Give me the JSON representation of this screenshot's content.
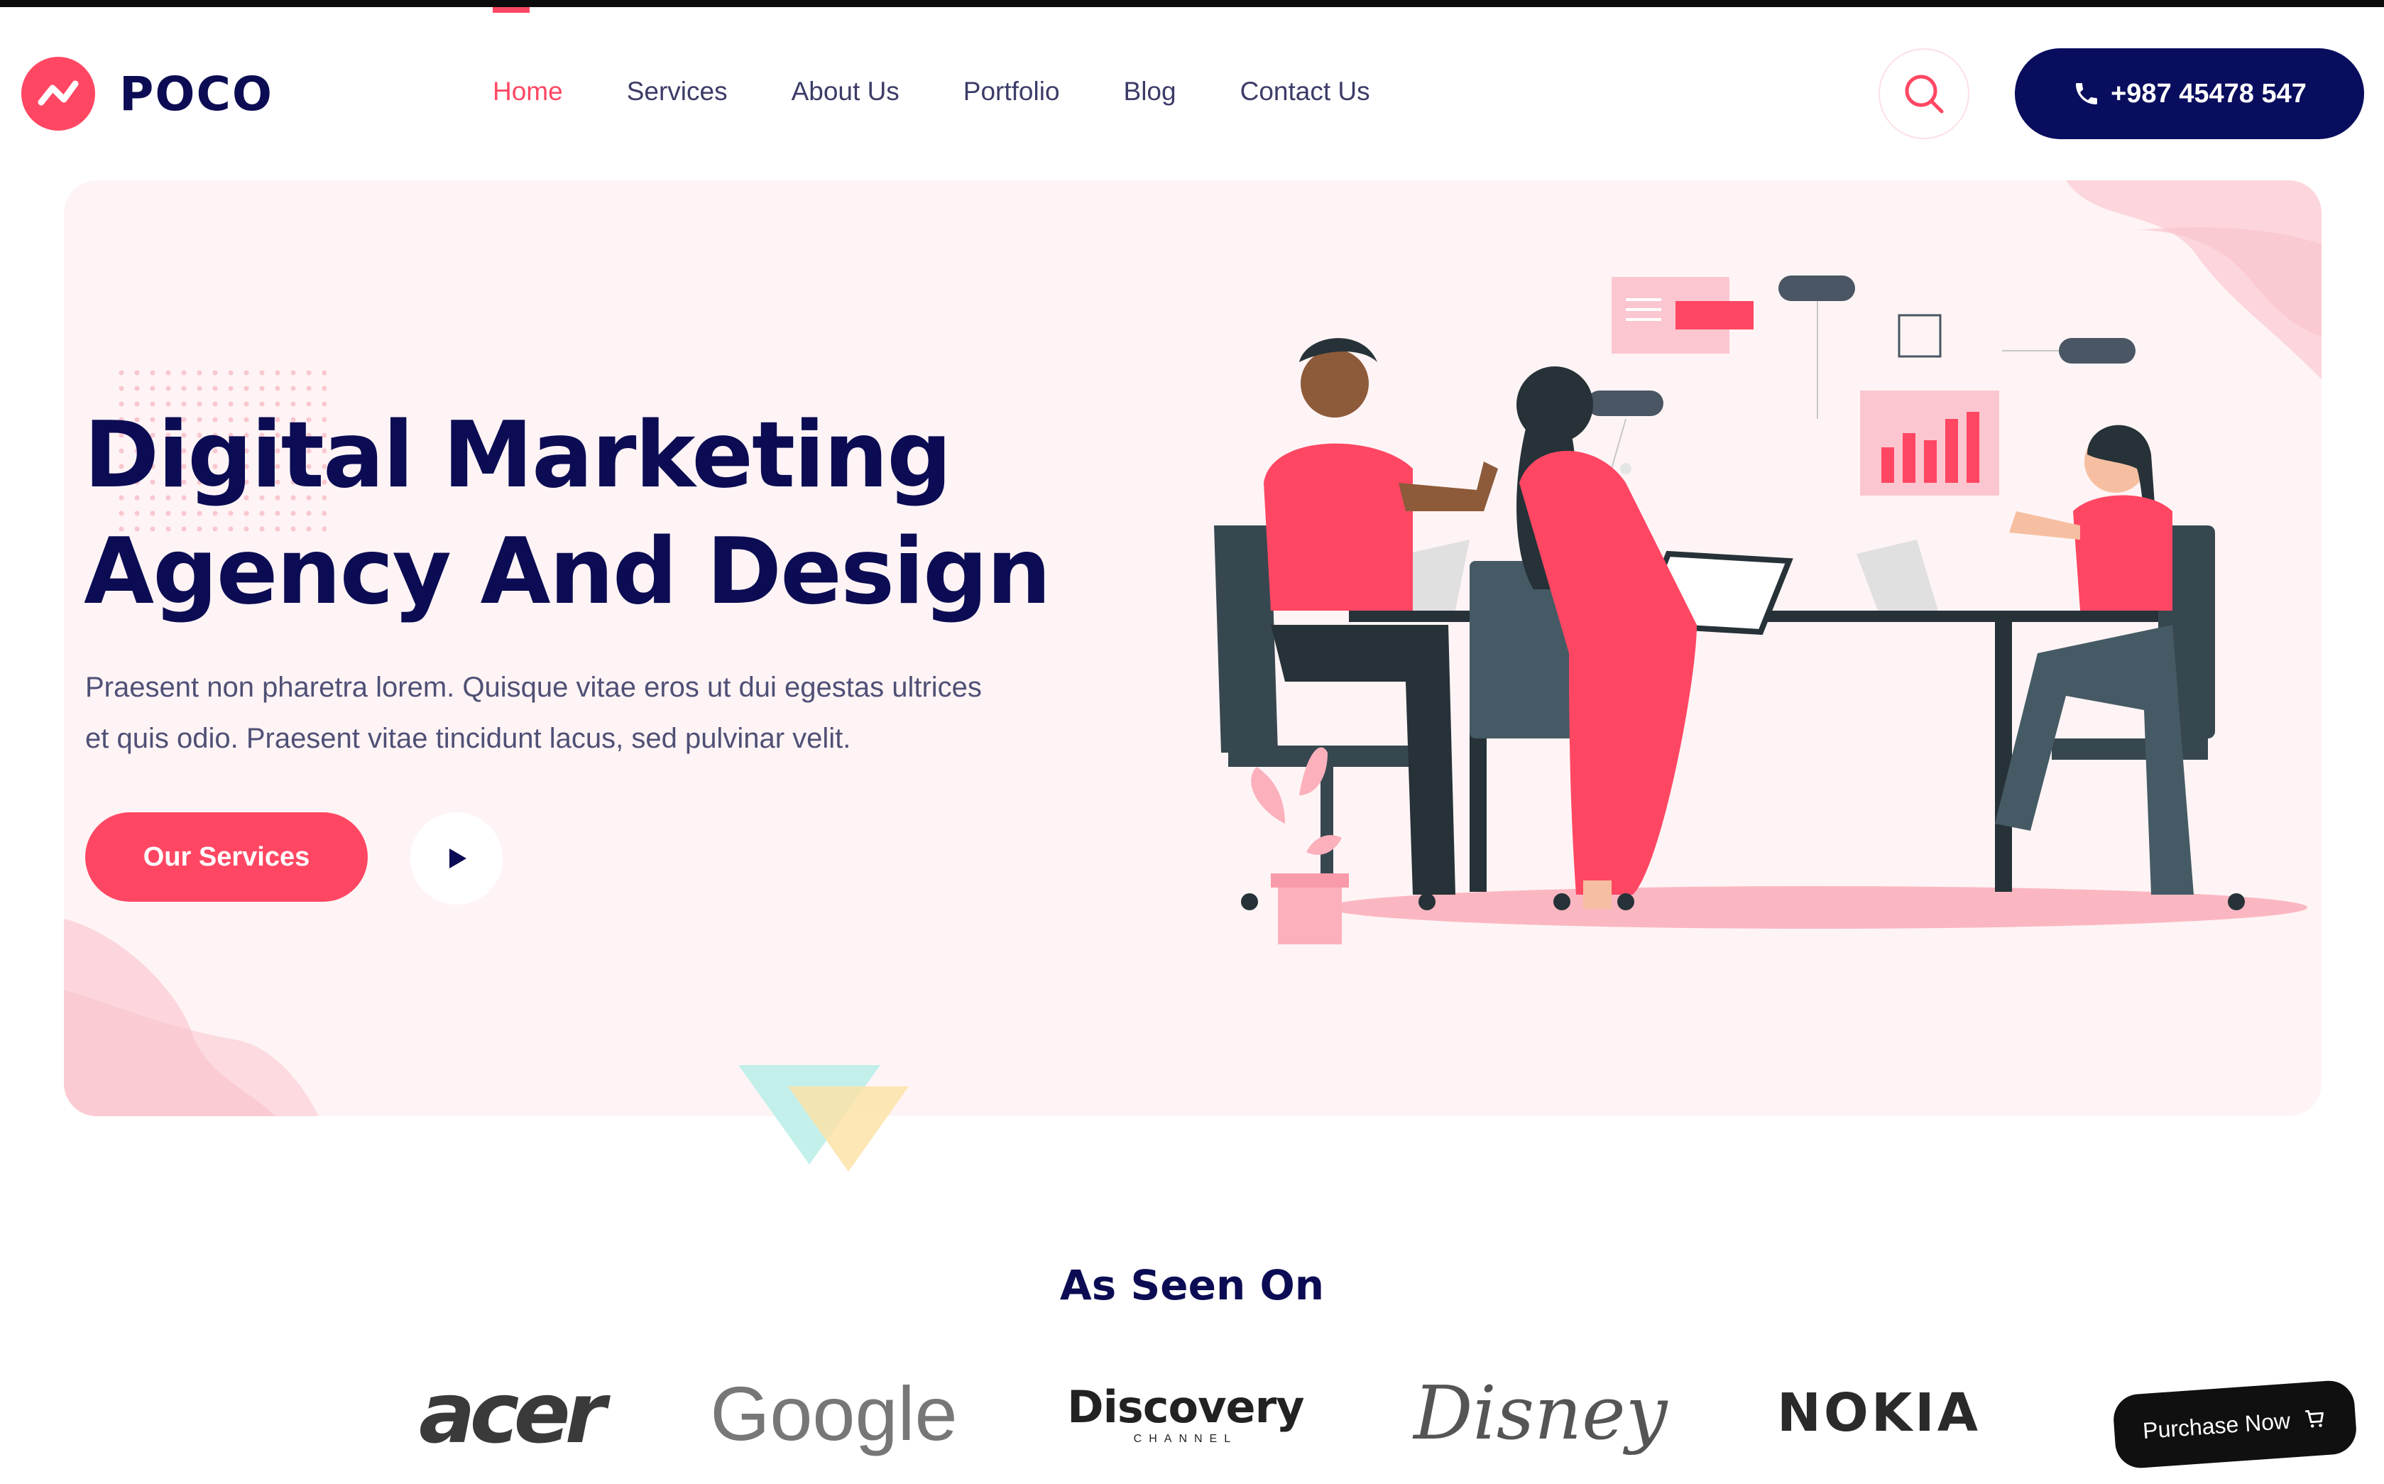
{
  "brand": {
    "name": "POCO",
    "accent": "#ff4763",
    "navy": "#0c0c54"
  },
  "nav": [
    {
      "label": "Home",
      "active": true
    },
    {
      "label": "Services",
      "active": false
    },
    {
      "label": "About Us",
      "active": false
    },
    {
      "label": "Portfolio",
      "active": false
    },
    {
      "label": "Blog",
      "active": false
    },
    {
      "label": "Contact Us",
      "active": false
    }
  ],
  "header": {
    "phone": "+987 45478 547",
    "search_icon": "search-icon",
    "phone_icon": "phone-icon"
  },
  "hero": {
    "title_line1": "Digital Marketing",
    "title_line2": "Agency And Design",
    "description_line1": "Praesent non pharetra lorem. Quisque vitae eros ut dui egestas ultrices",
    "description_line2": "et quis odio. Praesent vitae tincidunt lacus, sed pulvinar velit.",
    "cta_label": "Our Services",
    "play_icon": "play-icon"
  },
  "brands": {
    "heading": "As Seen On",
    "logos": [
      {
        "name": "acer"
      },
      {
        "name": "Google"
      },
      {
        "name": "Discovery",
        "sub": "CHANNEL"
      },
      {
        "name": "Disney"
      },
      {
        "name": "NOKIA"
      }
    ]
  },
  "purchase": {
    "label": "Purchase Now",
    "icon": "cart-icon"
  }
}
